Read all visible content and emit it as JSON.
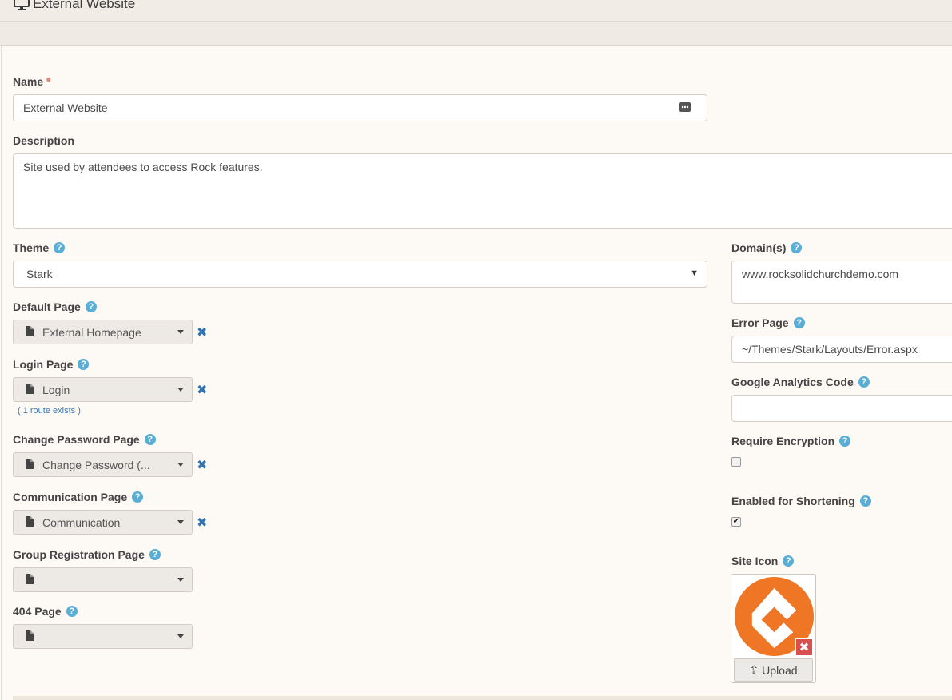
{
  "header": {
    "title": "External Website",
    "icon": "monitor-icon"
  },
  "form": {
    "name": {
      "label": "Name",
      "value": "External Website"
    },
    "description": {
      "label": "Description",
      "value": "Site used by attendees to access Rock features."
    },
    "theme": {
      "label": "Theme",
      "value": "Stark"
    },
    "default_page": {
      "label": "Default Page",
      "value": "External Homepage"
    },
    "login_page": {
      "label": "Login Page",
      "value": "Login",
      "route_note": "( 1 route exists )"
    },
    "change_password_page": {
      "label": "Change Password Page",
      "value": "Change Password (..."
    },
    "communication_page": {
      "label": "Communication Page",
      "value": "Communication"
    },
    "group_registration_page": {
      "label": "Group Registration Page",
      "value": ""
    },
    "page_404": {
      "label": "404 Page",
      "value": ""
    },
    "domains": {
      "label": "Domain(s)",
      "value": "www.rocksolidchurchdemo.com"
    },
    "error_page": {
      "label": "Error Page",
      "value": "~/Themes/Stark/Layouts/Error.aspx"
    },
    "google_analytics": {
      "label": "Google Analytics Code",
      "value": ""
    },
    "require_encryption": {
      "label": "Require Encryption",
      "checked": false
    },
    "enabled_shortening": {
      "label": "Enabled for Shortening",
      "checked": true
    },
    "site_icon": {
      "label": "Site Icon",
      "upload_label": "Upload"
    }
  },
  "colors": {
    "accent": "#5aaed6",
    "remove": "#2f74b2",
    "logo": "#ee7624",
    "danger": "#d65050"
  }
}
